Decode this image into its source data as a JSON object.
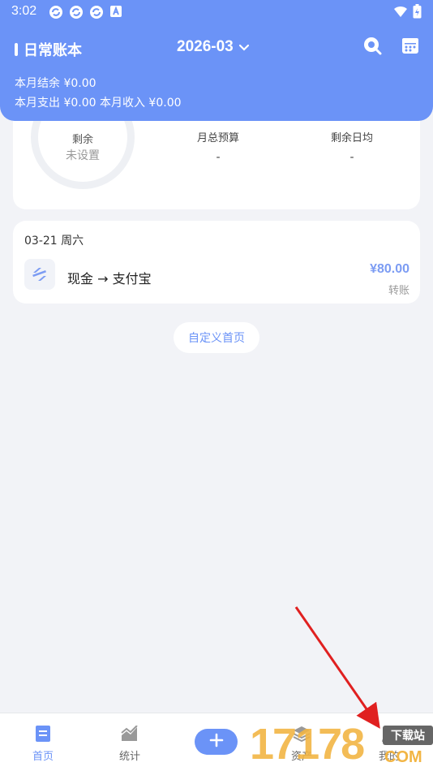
{
  "status_bar": {
    "time": "3:02",
    "icons": [
      "sync-icon",
      "sync-icon",
      "sync-icon",
      "translate-icon"
    ],
    "right_icons": [
      "wifi-icon",
      "battery-icon"
    ]
  },
  "header": {
    "book_name": "日常账本",
    "month": "2026-03",
    "summary_line1": "本月结余 ¥0.00",
    "summary_line2": "本月支出 ¥0.00 本月收入 ¥0.00",
    "accent_color": "#6b93f7"
  },
  "budget": {
    "remain_label": "剩余",
    "remain_value": "未设置",
    "monthly_budget_label": "月总预算",
    "monthly_budget_value": "-",
    "daily_avg_label": "剩余日均",
    "daily_avg_value": "-"
  },
  "transactions": [
    {
      "date": "03-21 周六",
      "title": "现金 → 支付宝",
      "amount": "¥80.00",
      "type": "转账"
    }
  ],
  "customize_button": "自定义首页",
  "tabs": [
    {
      "label": "首页",
      "icon": "home-icon",
      "active": true
    },
    {
      "label": "统计",
      "icon": "chart-icon",
      "active": false
    },
    {
      "label": "资产",
      "icon": "layers-icon",
      "active": false
    },
    {
      "label": "我的",
      "icon": "user-icon",
      "active": false
    }
  ],
  "watermark": {
    "digits": "17178",
    "box_text": "下载站",
    "domain_text": "COM"
  }
}
